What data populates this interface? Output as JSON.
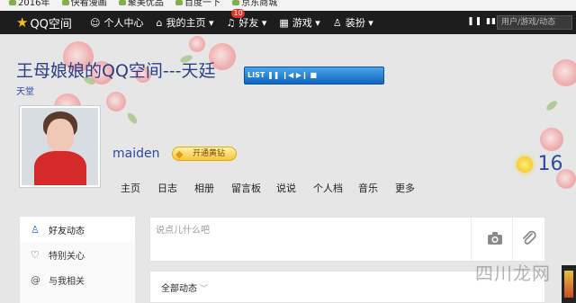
{
  "bookmarks": [
    "2016年",
    "快看漫画",
    "聚美优品",
    "百度一下",
    "京东商城"
  ],
  "nav": {
    "logo": "QQ空间",
    "items": [
      {
        "icon": "user-icon",
        "glyph": "☺",
        "label": "个人中心"
      },
      {
        "icon": "home-icon",
        "glyph": "⌂",
        "label": "我的主页 ▾"
      },
      {
        "icon": "bell-icon",
        "glyph": "♫",
        "label": "好友 ▾",
        "badge": "10"
      },
      {
        "icon": "grid-icon",
        "glyph": "▦",
        "label": "游戏 ▾"
      },
      {
        "icon": "shirt-icon",
        "glyph": "♙",
        "label": "装扮 ▾"
      }
    ],
    "tools": "❚❚  ▮▮",
    "search_placeholder": "用户/游戏/动态"
  },
  "header": {
    "title": "王母娘娘的QQ空间---天廷",
    "subtitle": "天堂",
    "player_label": "LIST ❚❚ ❙◀ ▶❙ ■"
  },
  "profile": {
    "username": "maiden",
    "vip_label": "开通黄钻",
    "temperature": "16"
  },
  "tabs": [
    "主页",
    "日志",
    "相册",
    "留言板",
    "说说",
    "个人档",
    "音乐",
    "更多"
  ],
  "left_menu": [
    {
      "icon": "friends-icon",
      "glyph": "♙",
      "label": "好友动态",
      "active": true
    },
    {
      "icon": "heart-icon",
      "glyph": "♡",
      "label": "特别关心",
      "active": false
    },
    {
      "icon": "at-icon",
      "glyph": "@",
      "label": "与我相关",
      "active": false
    }
  ],
  "post_box": {
    "placeholder": "说点儿什么吧"
  },
  "feed": {
    "filter": "全部动态"
  },
  "watermark": "四川龙网"
}
